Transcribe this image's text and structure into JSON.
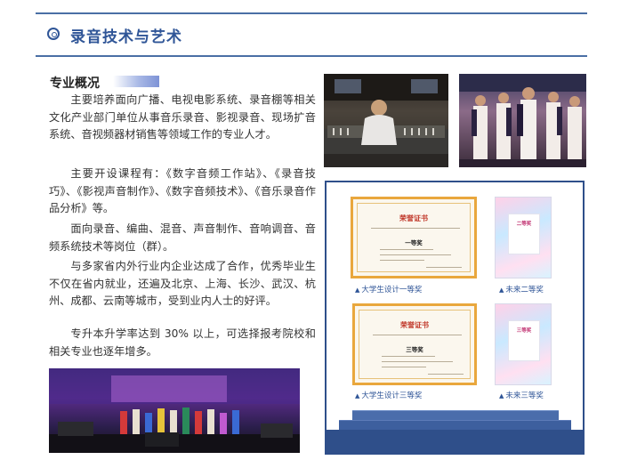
{
  "header": {
    "title": "录音技术与艺术",
    "icon": "target-circle-icon",
    "accent": "#2f5597"
  },
  "section": {
    "heading": "专业概况"
  },
  "paragraphs": [
    "主要培养面向广播、电视电影系统、录音棚等相关文化产业部门单位从事音乐录音、影视录音、现场扩音系统、音视频器材销售等领域工作的专业人才。",
    "主要开设课程有：《数字音频工作站》、《录音技巧》、《影视声音制作》、《数字音频技术》、《音乐录音作品分析》等。",
    "面向录音、编曲、混音、声音制作、音响调音、音频系统技术等岗位（群）。",
    "与多家省内外行业内企业达成了合作，优秀毕业生不仅在省内就业，还遍及北京、上海、长沙、武汉、杭州、成都、云南等城市，受到业内人士的好评。",
    "专升本升学率达到 30% 以上，可选择报考院校和相关专业也逐年增多。"
  ],
  "awards": {
    "cert1": {
      "title": "荣誉证书",
      "rank": "一等奖",
      "caption": "大学生设计一等奖"
    },
    "poster1": {
      "rank": "二等奖",
      "caption": "未来二等奖"
    },
    "cert2": {
      "title": "荣誉证书",
      "rank": "三等奖",
      "caption": "大学生设计三等奖"
    },
    "poster2": {
      "rank": "三等奖",
      "caption": "未来三等奖"
    }
  }
}
